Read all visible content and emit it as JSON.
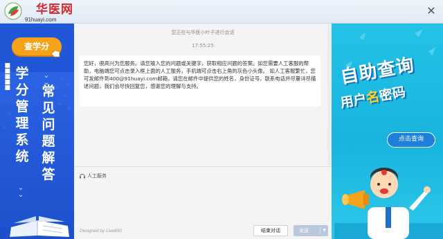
{
  "header": {
    "logo_cn": "华医网",
    "logo_url": "91huayi.com",
    "close_icon": "close-icon"
  },
  "left_banner": {
    "cta_label": "查学分",
    "column_a": [
      "学",
      "分",
      "管",
      "理",
      "系",
      "统"
    ],
    "column_b": [
      "常",
      "见",
      "问",
      "题",
      "解",
      "答"
    ],
    "colors": {
      "background": "#1f57d6",
      "cta": "#f7a21b"
    }
  },
  "chat": {
    "connecting_text": "您正在与华医小叶子进行会话",
    "timestamp": "17:55:25",
    "welcome_message": "您好，很高兴为您服务。请您输入您的问题或关键字，获取相应问题的答案。如您需要人工客服的帮助，电脑端您可点击录入框上面的人工服务，手机端可点击右上角的灰色小头像。 如人工客服繁忙，您可发邮件到400@91huayi.com邮箱，请您在邮件中提供您的姓名，身份证号，联系电话并尽量详尽描述问题，我们会尽快回复您，感谢您的理解与支持。",
    "service_label": "人工服务",
    "powered_by": "Designed by Live800",
    "end_button": "结束对话",
    "send_button": "发送"
  },
  "right_banner": {
    "title_line1": "自助查询",
    "title_line2_a": "用户",
    "title_line2_b": "名",
    "title_line2_c": "密码",
    "button_label": "点击查询",
    "colors": {
      "background": "#23c2e6",
      "accent": "#ffd21f"
    }
  }
}
